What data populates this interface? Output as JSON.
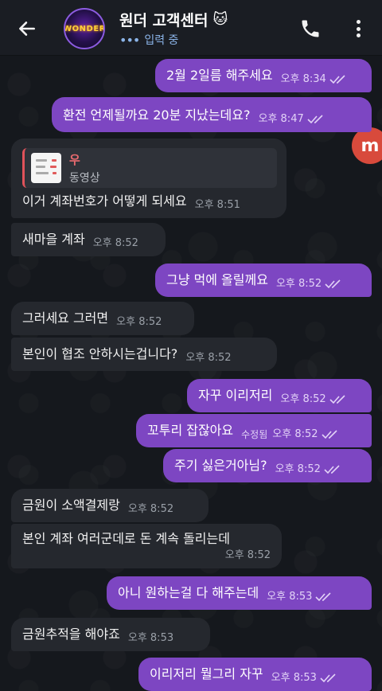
{
  "header": {
    "title": "원더 고객센터",
    "title_emoji": "🐱",
    "status": "입력 중",
    "avatar_text": "WONDER",
    "back_icon": "arrow-left-icon",
    "call_icon": "phone-icon",
    "more_icon": "more-vertical-icon"
  },
  "side_badge": {
    "text": "m"
  },
  "quote": {
    "name": "우",
    "subtitle": "동영상"
  },
  "messages": [
    {
      "dir": "out",
      "text": "2월 2일름 해주세요",
      "time": "오후 8:34"
    },
    {
      "dir": "out",
      "text": "환전 언제될까요 20분 지났는데요?",
      "time": "오후 8:47"
    },
    {
      "dir": "in",
      "text": "이거 계좌번호가 어떻게 되세요",
      "time": "오후 8:51"
    },
    {
      "dir": "in",
      "text": "새마을 계좌",
      "time": "오후 8:52"
    },
    {
      "dir": "out",
      "text": "그냥 먹에 올릴께요",
      "time": "오후 8:52"
    },
    {
      "dir": "in",
      "text": "그러세요 그러면",
      "time": "오후 8:52"
    },
    {
      "dir": "in",
      "text": "본인이 협조 안하시는겁니다?",
      "time": "오후 8:52"
    },
    {
      "dir": "out",
      "text": "자꾸 이리저리",
      "time": "오후 8:52"
    },
    {
      "dir": "out",
      "text": "꼬투리 잡잖아요",
      "time": "오후 8:52",
      "edited": "수정됨"
    },
    {
      "dir": "out",
      "text": "주기 싫은거아님?",
      "time": "오후 8:52"
    },
    {
      "dir": "in",
      "text": "금원이 소액결제랑",
      "time": "오후 8:52"
    },
    {
      "dir": "in",
      "text": "본인 계좌 여러군데로 돈 계속 돌리는데",
      "time": "오후 8:52"
    },
    {
      "dir": "out",
      "text": "아니 원하는걸 다 해주는데",
      "time": "오후 8:53"
    },
    {
      "dir": "in",
      "text": "금원추적을 해야죠",
      "time": "오후 8:53"
    },
    {
      "dir": "out",
      "text": "이리저리 뭘그리 자꾸",
      "time": "오후 8:53"
    }
  ],
  "colors": {
    "outgoing": "#7d46c2",
    "incoming": "#25282e",
    "header": "#1a1d23"
  }
}
